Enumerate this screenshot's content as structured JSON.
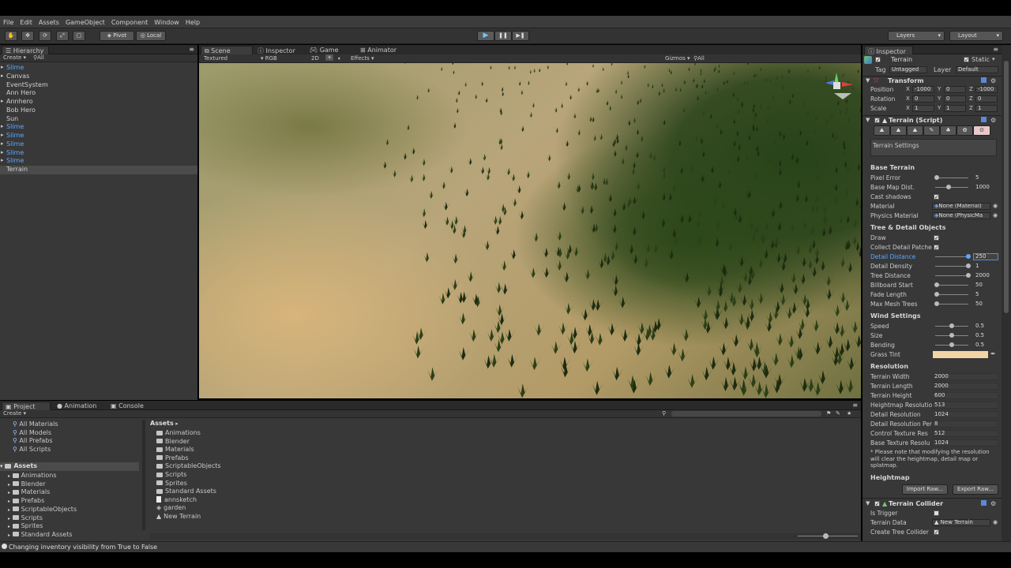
{
  "menu": [
    "File",
    "Edit",
    "Assets",
    "GameObject",
    "Component",
    "Window",
    "Help"
  ],
  "toolbar": {
    "pivot": "Pivot",
    "local": "Local",
    "layers": "Layers",
    "layout": "Layout"
  },
  "hierarchy": {
    "tab": "Hierarchy",
    "create": "Create",
    "search": "All",
    "items": [
      {
        "label": "Slime",
        "blue": true,
        "arrow": true
      },
      {
        "label": "Canvas",
        "blue": false,
        "arrow": true
      },
      {
        "label": "EventSystem",
        "blue": false,
        "arrow": false
      },
      {
        "label": "Ann Hero",
        "blue": false,
        "arrow": false
      },
      {
        "label": "Annhero",
        "blue": false,
        "arrow": true
      },
      {
        "label": "Bob Hero",
        "blue": false,
        "arrow": false
      },
      {
        "label": "Sun",
        "blue": false,
        "arrow": false
      },
      {
        "label": "Slime",
        "blue": true,
        "arrow": true
      },
      {
        "label": "Slime",
        "blue": true,
        "arrow": true
      },
      {
        "label": "Slime",
        "blue": true,
        "arrow": true
      },
      {
        "label": "Slime",
        "blue": true,
        "arrow": true
      },
      {
        "label": "Slime",
        "blue": true,
        "arrow": true
      },
      {
        "label": "Terrain",
        "blue": false,
        "arrow": false,
        "selected": true
      }
    ]
  },
  "scene_tabs": {
    "scene": "Scene",
    "inspector": "Inspector",
    "game": "Game",
    "animator": "Animator",
    "textured": "Textured",
    "rgb": "RGB",
    "two_d": "2D",
    "effects": "Effects",
    "gizmos": "Gizmos",
    "all": "All"
  },
  "project": {
    "tab_project": "Project",
    "tab_animation": "Animation",
    "tab_console": "Console",
    "create": "Create",
    "favorites": [
      "All Materials",
      "All Models",
      "All Prefabs",
      "All Scripts"
    ],
    "tree_root": "Assets",
    "tree": [
      "Animations",
      "Blender",
      "Materials",
      "Prefabs",
      "ScriptableObjects",
      "Scripts",
      "Sprites",
      "Standard Assets"
    ],
    "breadcrumb": "Assets",
    "assets": [
      {
        "label": "Animations",
        "kind": "folder"
      },
      {
        "label": "Blender",
        "kind": "folder"
      },
      {
        "label": "Materials",
        "kind": "folder"
      },
      {
        "label": "Prefabs",
        "kind": "folder"
      },
      {
        "label": "ScriptableObjects",
        "kind": "folder"
      },
      {
        "label": "Scripts",
        "kind": "folder"
      },
      {
        "label": "Sprites",
        "kind": "folder"
      },
      {
        "label": "Standard Assets",
        "kind": "folder"
      },
      {
        "label": "annsketch",
        "kind": "file"
      },
      {
        "label": "garden",
        "kind": "scene"
      },
      {
        "label": "New Terrain",
        "kind": "terrain"
      }
    ]
  },
  "status": "Changing inventory visibility from True to False",
  "inspector": {
    "tab": "Inspector",
    "object_name": "Terrain",
    "static": "Static",
    "tag_label": "Tag",
    "tag_value": "Untagged",
    "layer_label": "Layer",
    "layer_value": "Default",
    "transform": {
      "title": "Transform",
      "position": {
        "label": "Position",
        "x": "-1000",
        "y": "0",
        "z": "-1000"
      },
      "rotation": {
        "label": "Rotation",
        "x": "0",
        "y": "0",
        "z": "0"
      },
      "scale": {
        "label": "Scale",
        "x": "1",
        "y": "1",
        "z": "1"
      }
    },
    "terrain_script": {
      "title": "Terrain (Script)",
      "settings_label": "Terrain Settings"
    },
    "base_terrain": {
      "title": "Base Terrain",
      "pixel_error": {
        "label": "Pixel Error",
        "value": "5",
        "fraction": 0.04
      },
      "base_map_dist": {
        "label": "Base Map Dist.",
        "value": "1000",
        "fraction": 0.4
      },
      "cast_shadows": {
        "label": "Cast shadows",
        "checked": true
      },
      "material": {
        "label": "Material",
        "value": "None (Material)"
      },
      "physics_material": {
        "label": "Physics Material",
        "value": "None (PhysicMa"
      }
    },
    "tree_detail": {
      "title": "Tree & Detail Objects",
      "draw": {
        "label": "Draw",
        "checked": true
      },
      "collect": {
        "label": "Collect Detail Patche",
        "checked": true
      },
      "detail_distance": {
        "label": "Detail Distance",
        "value": "250",
        "fraction": 1.0
      },
      "detail_density": {
        "label": "Detail Density",
        "value": "1",
        "fraction": 1.0
      },
      "tree_distance": {
        "label": "Tree Distance",
        "value": "2000",
        "fraction": 1.0
      },
      "billboard_start": {
        "label": "Billboard Start",
        "value": "50",
        "fraction": 0.05
      },
      "fade_length": {
        "label": "Fade Length",
        "value": "5",
        "fraction": 0.05
      },
      "max_mesh_trees": {
        "label": "Max Mesh Trees",
        "value": "50",
        "fraction": 0.05
      }
    },
    "wind": {
      "title": "Wind Settings",
      "speed": {
        "label": "Speed",
        "value": "0.5",
        "fraction": 0.5
      },
      "size": {
        "label": "Size",
        "value": "0.5",
        "fraction": 0.5
      },
      "bending": {
        "label": "Bending",
        "value": "0.5",
        "fraction": 0.5
      },
      "grass_tint": {
        "label": "Grass Tint",
        "color": "#f3d4a4"
      }
    },
    "resolution": {
      "title": "Resolution",
      "rows": [
        {
          "label": "Terrain Width",
          "value": "2000"
        },
        {
          "label": "Terrain Length",
          "value": "2000"
        },
        {
          "label": "Terrain Height",
          "value": "600"
        },
        {
          "label": "Heightmap Resolutio",
          "value": "513"
        },
        {
          "label": "Detail Resolution",
          "value": "1024"
        },
        {
          "label": "Detail Resolution Per",
          "value": "8"
        },
        {
          "label": "Control Texture Res",
          "value": "512"
        },
        {
          "label": "Base Texture Resolu",
          "value": "1024"
        }
      ],
      "note": "* Please note that modifying the resolution will clear the heightmap, detail map or splatmap."
    },
    "heightmap": {
      "title": "Heightmap",
      "import": "Import Raw...",
      "export": "Export Raw..."
    },
    "collider": {
      "title": "Terrain Collider",
      "is_trigger": {
        "label": "Is Trigger",
        "checked": false
      },
      "terrain_data": {
        "label": "Terrain Data",
        "value": "New Terrain"
      },
      "create_tree": {
        "label": "Create Tree Collider",
        "checked": true
      }
    }
  }
}
